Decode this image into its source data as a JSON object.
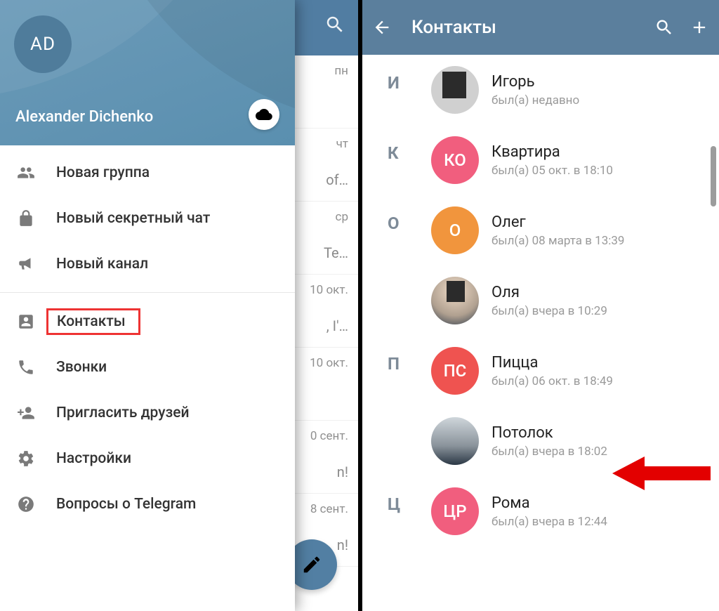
{
  "drawer": {
    "avatar_initials": "AD",
    "user_name": "Alexander Dichenko",
    "menu": [
      {
        "id": "new-group",
        "label": "Новая группа",
        "icon": "group"
      },
      {
        "id": "secret-chat",
        "label": "Новый секретный чат",
        "icon": "lock"
      },
      {
        "id": "new-channel",
        "label": "Новый канал",
        "icon": "megaphone"
      },
      {
        "id": "contacts",
        "label": "Контакты",
        "icon": "contact",
        "highlighted": true
      },
      {
        "id": "calls",
        "label": "Звонки",
        "icon": "phone"
      },
      {
        "id": "invite",
        "label": "Пригласить друзей",
        "icon": "person-add"
      },
      {
        "id": "settings",
        "label": "Настройки",
        "icon": "gear"
      },
      {
        "id": "faq",
        "label": "Вопросы о Telegram",
        "icon": "help"
      }
    ]
  },
  "chat_strip": {
    "rows": [
      {
        "date": "пн",
        "msg": ""
      },
      {
        "date": "чт",
        "msg": "of…"
      },
      {
        "date": "ср",
        "msg": "Te…"
      },
      {
        "date": "10 окт.",
        "msg": ", I'…"
      },
      {
        "date": "10 окт.",
        "msg": ""
      },
      {
        "date": "0 сент.",
        "msg": "n!"
      },
      {
        "date": "8 сент.",
        "msg": "n!"
      }
    ]
  },
  "contacts": {
    "title": "Контакты",
    "sections": [
      {
        "letter": "И",
        "items": [
          {
            "name": "Игорь",
            "status": "был(а) недавно",
            "avatar": {
              "type": "photo1"
            }
          }
        ]
      },
      {
        "letter": "К",
        "items": [
          {
            "name": "Квартира",
            "status": "был(а) 05 окт. в 18:10",
            "avatar": {
              "type": "initials",
              "text": "КО",
              "cls": "av-pink"
            }
          }
        ]
      },
      {
        "letter": "О",
        "items": [
          {
            "name": "Олег",
            "status": "был(а) 08 марта в 13:39",
            "avatar": {
              "type": "initials",
              "text": "О",
              "cls": "av-orange"
            }
          },
          {
            "name": "Оля",
            "status": "был(а) вчера в 10:29",
            "avatar": {
              "type": "photo2"
            }
          }
        ]
      },
      {
        "letter": "П",
        "items": [
          {
            "name": "Пицца",
            "status": "был(а) 06 окт. в 18:49",
            "avatar": {
              "type": "initials",
              "text": "ПС",
              "cls": "av-red"
            }
          },
          {
            "name": "Потолок",
            "status": "был(а) вчера в 18:02",
            "avatar": {
              "type": "photo3"
            },
            "arrow": true
          }
        ]
      },
      {
        "letter": "Ц",
        "items": [
          {
            "name": "Рома",
            "status": "был(а) вчера в 12:44",
            "avatar": {
              "type": "initials",
              "text": "ЦР",
              "cls": "av-pink"
            }
          }
        ]
      }
    ]
  }
}
